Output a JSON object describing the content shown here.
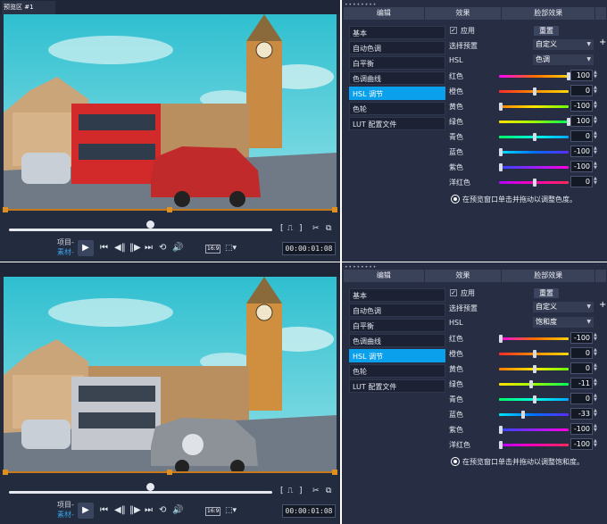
{
  "top": {
    "preview": {
      "title_tag": "预览区 #1",
      "label_project": "项目-",
      "label_source": "素材-",
      "timecode": "00:00:01:08",
      "aspect": "16:9"
    },
    "panel": {
      "tabs": [
        "编辑",
        "效果",
        "脸部效果"
      ],
      "side_items": [
        "基本",
        "自动色调",
        "白平衡",
        "色调曲线",
        "HSL 调节",
        "色轮",
        "LUT 配置文件"
      ],
      "active_item": "HSL 调节",
      "apply_label": "应用",
      "reset_label": "重置",
      "preset_label": "选择预置",
      "preset_value": "自定义",
      "hsl_label": "HSL",
      "hsl_value": "色调",
      "sliders": [
        {
          "label": "红色",
          "value": "100"
        },
        {
          "label": "橙色",
          "value": "0"
        },
        {
          "label": "黄色",
          "value": "-100"
        },
        {
          "label": "绿色",
          "value": "100"
        },
        {
          "label": "青色",
          "value": "0"
        },
        {
          "label": "蓝色",
          "value": "-100"
        },
        {
          "label": "紫色",
          "value": "-100"
        },
        {
          "label": "洋红色",
          "value": "0"
        }
      ],
      "hint": "在预览窗口单击并拖动以调整色度。"
    }
  },
  "bottom": {
    "preview": {
      "label_project": "项目-",
      "label_source": "素材-",
      "timecode": "00:00:01:08",
      "aspect": "16:9"
    },
    "panel": {
      "tabs": [
        "编辑",
        "效果",
        "脸部效果"
      ],
      "side_items": [
        "基本",
        "自动色调",
        "白平衡",
        "色调曲线",
        "HSL 调节",
        "色轮",
        "LUT 配置文件"
      ],
      "active_item": "HSL 调节",
      "apply_label": "应用",
      "reset_label": "重置",
      "preset_label": "选择预置",
      "preset_value": "自定义",
      "hsl_label": "HSL",
      "hsl_value": "饱和度",
      "sliders": [
        {
          "label": "红色",
          "value": "-100"
        },
        {
          "label": "橙色",
          "value": "0"
        },
        {
          "label": "黄色",
          "value": "0"
        },
        {
          "label": "绿色",
          "value": "-11"
        },
        {
          "label": "青色",
          "value": "0"
        },
        {
          "label": "蓝色",
          "value": "-33"
        },
        {
          "label": "紫色",
          "value": "-100"
        },
        {
          "label": "洋红色",
          "value": "-100"
        }
      ],
      "hint": "在预览窗口单击并拖动以调整饱和度。"
    }
  },
  "colors": {
    "accent": "#0aa0ec",
    "panel_bg": "#272e43",
    "timeline_orange": "#e0901e"
  }
}
